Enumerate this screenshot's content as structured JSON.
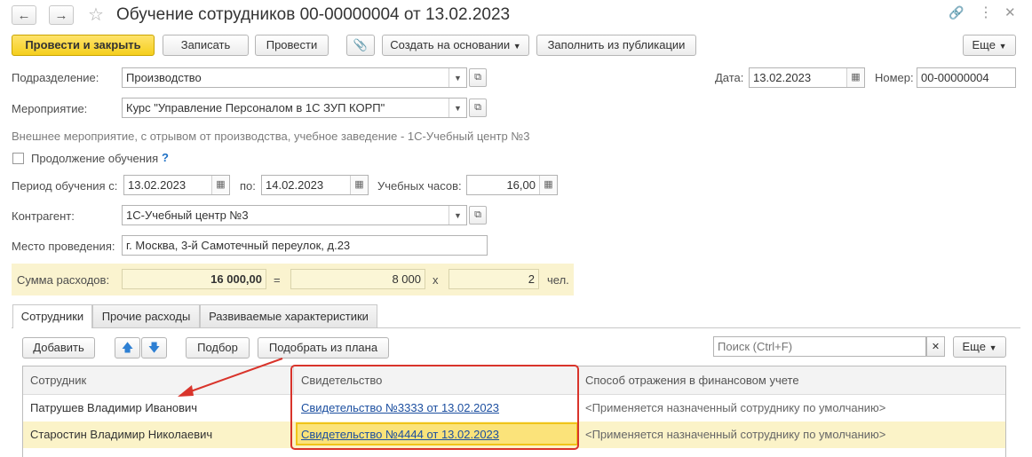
{
  "window": {
    "title": "Обучение сотрудников 00-00000004 от 13.02.2023"
  },
  "icons": {
    "back": "arrow-left-icon",
    "forward": "arrow-right-icon",
    "favorite": "star-icon",
    "link": "link-icon",
    "menu": "more-vertical-icon",
    "close": "close-icon",
    "attach": "paperclip-icon",
    "calendar": "calendar-icon",
    "open": "open-form-icon",
    "dropdown": "chevron-down-icon",
    "up": "arrow-up-icon",
    "down": "arrow-down-icon",
    "clear": "clear-icon",
    "help": "question-icon"
  },
  "colors": {
    "primary": "#f5cf1d",
    "highlight_row": "#fbf3c8",
    "annotation": "#d9342b",
    "link": "#1c4fa0"
  },
  "toolbar": {
    "post_close": "Провести и закрыть",
    "save": "Записать",
    "post": "Провести",
    "create_based": "Создать на основании",
    "fill_pub": "Заполнить из публикации",
    "more": "Еще"
  },
  "form": {
    "division_label": "Подразделение:",
    "division_value": "Производство",
    "date_label": "Дата:",
    "date_value": "13.02.2023",
    "number_label": "Номер:",
    "number_value": "00-00000004",
    "event_label": "Мероприятие:",
    "event_value": "Курс \"Управление Персоналом в 1С ЗУП КОРП\"",
    "event_info": "Внешнее мероприятие, с отрывом от производства, учебное заведение - 1С-Учебный центр №3",
    "continuation_label": "Продолжение обучения",
    "help_mark": "?",
    "period_label": "Период обучения с:",
    "period_from": "13.02.2023",
    "period_to_label": "по:",
    "period_to": "14.02.2023",
    "hours_label": "Учебных часов:",
    "hours_value": "16,00",
    "contractor_label": "Контрагент:",
    "contractor_value": "1С-Учебный центр №3",
    "place_label": "Место проведения:",
    "place_value": "г. Москва, 3-й Самотечный переулок, д.23",
    "expenses_label": "Сумма расходов:",
    "expenses_total": "16 000,00",
    "equals": "=",
    "per_person": "8 000",
    "times": "x",
    "persons": "2",
    "persons_unit": "чел."
  },
  "tabs": [
    {
      "label": "Сотрудники"
    },
    {
      "label": "Прочие расходы"
    },
    {
      "label": "Развиваемые характеристики"
    }
  ],
  "table_toolbar": {
    "add": "Добавить",
    "pick": "Подбор",
    "pick_plan": "Подобрать из плана",
    "search_placeholder": "Поиск (Ctrl+F)",
    "more": "Еще"
  },
  "table": {
    "columns": [
      "Сотрудник",
      "Свидетельство",
      "Способ отражения в финансовом учете"
    ],
    "rows": [
      {
        "employee": "Патрушев Владимир Иванович",
        "certificate": "Свидетельство №3333 от 13.02.2023",
        "accounting": "<Применяется назначенный сотруднику по умолчанию>"
      },
      {
        "employee": "Старостин Владимир Николаевич",
        "certificate": "Свидетельство №4444 от 13.02.2023",
        "accounting": "<Применяется назначенный сотруднику по умолчанию>"
      }
    ]
  }
}
